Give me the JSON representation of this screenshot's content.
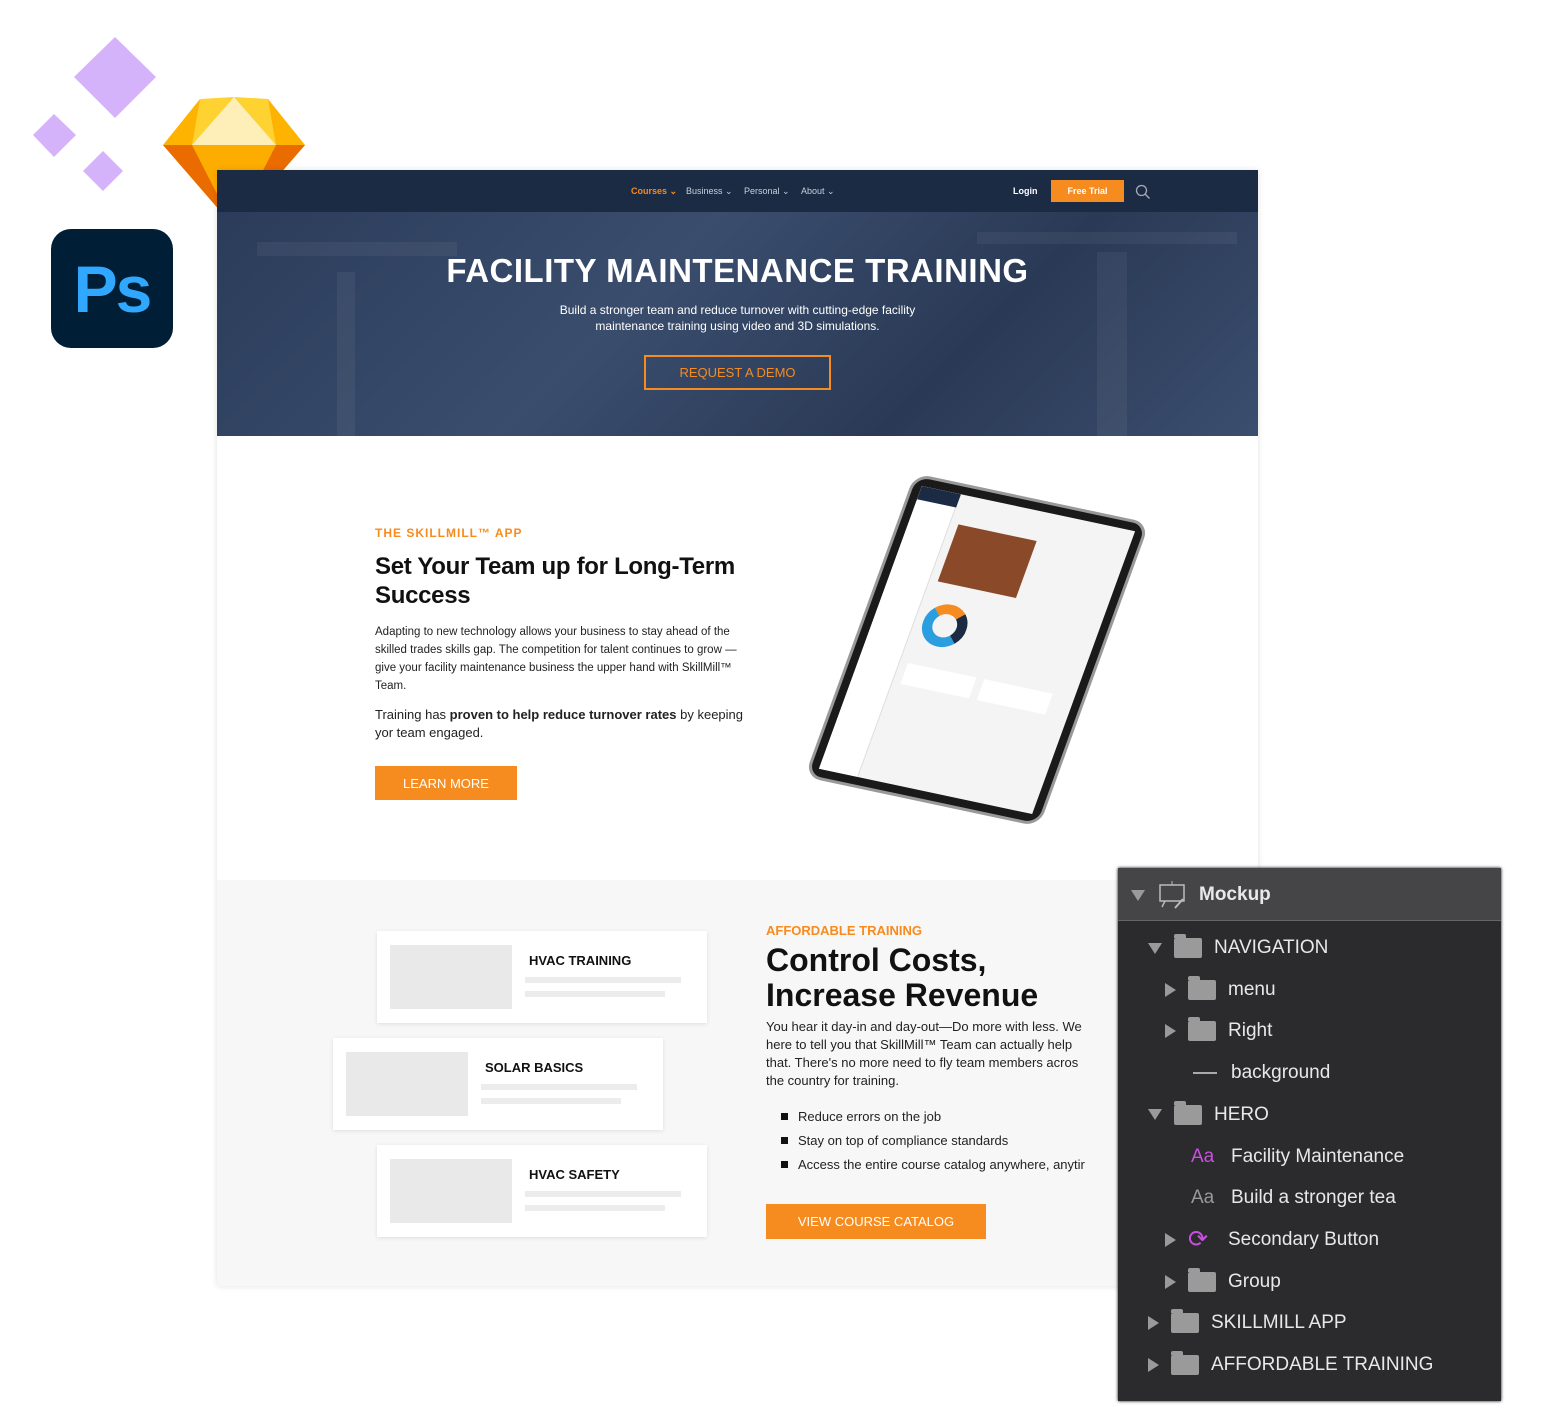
{
  "nav": {
    "items": [
      "Courses",
      "Business",
      "Personal",
      "About"
    ],
    "login": "Login",
    "free_trial": "Free Trial"
  },
  "hero": {
    "title": "FACILITY MAINTENANCE TRAINING",
    "sub1": "Build a stronger team and reduce turnover with cutting-edge facility",
    "sub2": "maintenance training using video and 3D simulations.",
    "cta": "REQUEST A DEMO"
  },
  "app": {
    "eyebrow": "THE SKILLMILL™ APP",
    "h1": "Set Your Team up for Long-Term",
    "h2": "Success",
    "p1": "Adapting to new technology allows your business to stay ahead of the skilled trades skills gap.  The competition for talent continues to grow —give your facility maintenance business the upper hand with SkillMill™ Team.",
    "p2a": "Training has ",
    "p2b": "proven to help reduce turnover rates",
    "p2c": " by keeping yor team engaged.",
    "cta": "LEARN MORE"
  },
  "afford": {
    "eyebrow": "AFFORDABLE TRAINING",
    "h1": "Control Costs,",
    "h2": "Increase Revenue",
    "lines": [
      "You hear it day-in and day-out—Do more with less. We",
      "here to tell you that SkillMill™ Team can actually help",
      "that. There's no more need to fly team members acros",
      "the country for training."
    ],
    "bullets": [
      "Reduce errors on the job",
      "Stay on top of compliance standards",
      "Access the entire course catalog anywhere, anytir"
    ],
    "cta": "VIEW COURSE CATALOG",
    "cards": [
      "HVAC TRAINING",
      "SOLAR BASICS",
      "HVAC SAFETY"
    ]
  },
  "layers": {
    "root": "Mockup",
    "items": [
      {
        "label": "NAVIGATION",
        "type": "folder",
        "state": "open"
      },
      {
        "label": "menu",
        "type": "folder",
        "state": "closed"
      },
      {
        "label": "Right",
        "type": "folder",
        "state": "closed"
      },
      {
        "label": "background",
        "type": "shape"
      },
      {
        "label": "HERO",
        "type": "folder",
        "state": "open"
      },
      {
        "label": "Facility Maintenance",
        "type": "text"
      },
      {
        "label": "Build a stronger tea",
        "type": "text"
      },
      {
        "label": "Secondary Button",
        "type": "symbol",
        "state": "closed"
      },
      {
        "label": "Group",
        "type": "folder",
        "state": "closed"
      },
      {
        "label": "SKILLMILL APP",
        "type": "folder",
        "state": "closed"
      },
      {
        "label": "AFFORDABLE TRAINING",
        "type": "folder",
        "state": "closed"
      }
    ],
    "text_icon": "Aa"
  },
  "logos": {
    "ps": "Ps"
  },
  "colors": {
    "accent": "#f68b1f",
    "nav": "#1c2b44",
    "panel": "#2b2b2d",
    "symbol": "#c94fe0"
  }
}
